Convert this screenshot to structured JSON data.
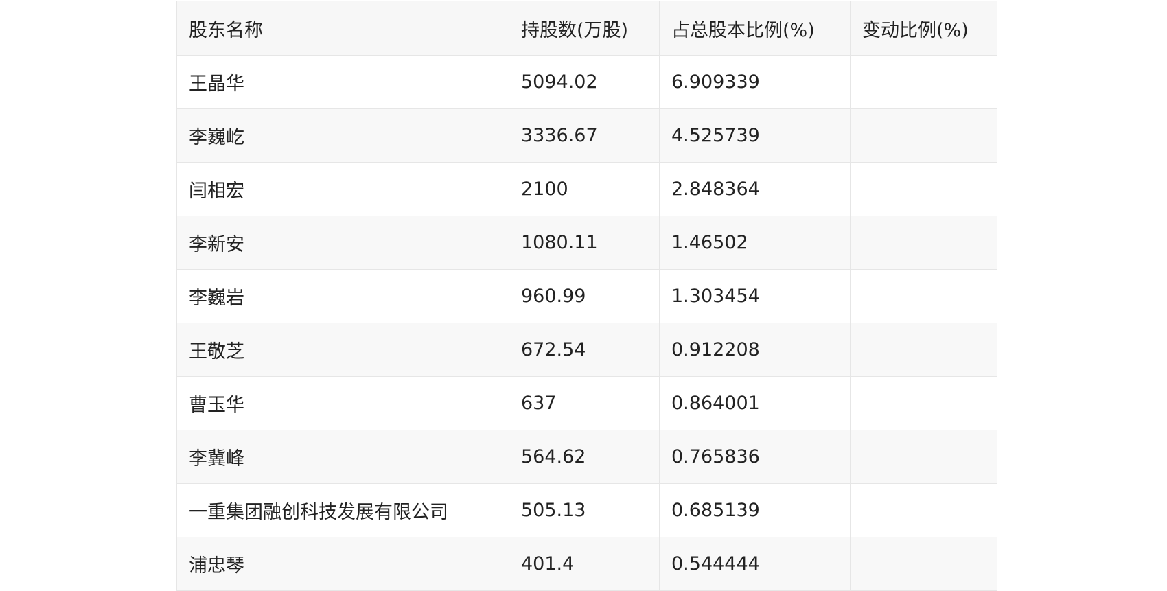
{
  "table": {
    "headers": [
      "股东名称",
      "持股数(万股)",
      "占总股本比例(%)",
      "变动比例(%)"
    ],
    "rows": [
      [
        "王晶华",
        "5094.02",
        "6.909339",
        ""
      ],
      [
        "李巍屹",
        "3336.67",
        "4.525739",
        ""
      ],
      [
        "闫相宏",
        "2100",
        "2.848364",
        ""
      ],
      [
        "李新安",
        "1080.11",
        "1.46502",
        ""
      ],
      [
        "李巍岩",
        "960.99",
        "1.303454",
        ""
      ],
      [
        "王敬芝",
        "672.54",
        "0.912208",
        ""
      ],
      [
        "曹玉华",
        "637",
        "0.864001",
        ""
      ],
      [
        "李冀峰",
        "564.62",
        "0.765836",
        ""
      ],
      [
        "一重集团融创科技发展有限公司",
        "505.13",
        "0.685139",
        ""
      ],
      [
        "浦忠琴",
        "401.4",
        "0.544444",
        ""
      ]
    ]
  }
}
